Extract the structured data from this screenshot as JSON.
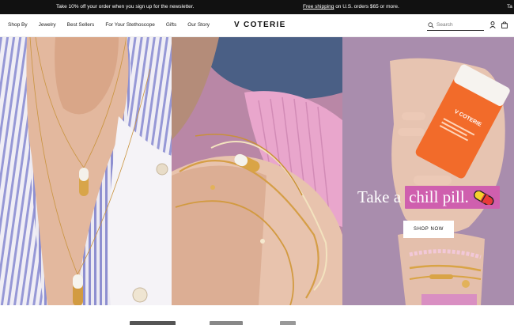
{
  "announcement": {
    "promo": "Take 10% off your order when you sign up for the newsletter.",
    "shipping": "Free shipping on U.S. orders $65 or more.",
    "shipping_link": "Free shipping",
    "shipping_rest": " on U.S. orders $65 or more.",
    "cutoff": "Ta"
  },
  "header": {
    "nav": [
      "Shop By",
      "Jewelry",
      "Best Sellers",
      "For Your Stethoscope",
      "Gifts",
      "Our Story"
    ],
    "logo": "V COTERIE",
    "search_placeholder": "Search",
    "icons": [
      "search-icon",
      "account-icon",
      "cart-icon"
    ]
  },
  "hero": {
    "headline_prefix": "Take a",
    "headline_highlight": "chill pill.",
    "cta": "SHOP NOW",
    "accent_color": "#cf5fae",
    "bottle_brand": "V COTERIE"
  }
}
